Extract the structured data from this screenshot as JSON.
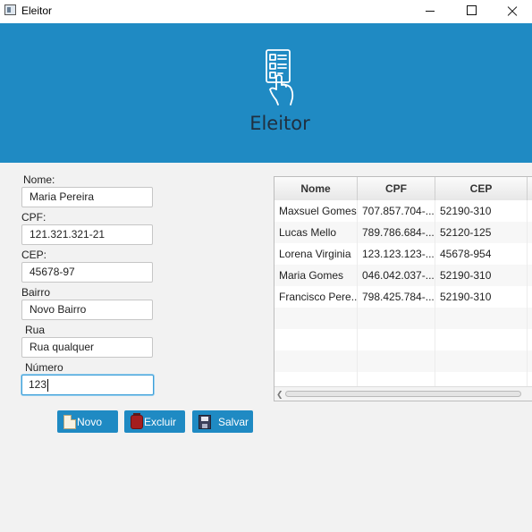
{
  "window": {
    "title": "Eleitor",
    "controls": [
      "minimize-icon",
      "maximize-icon",
      "close-icon"
    ]
  },
  "header": {
    "title": "Eleitor",
    "icon": "ballot-hand-icon",
    "background": "#1f8ac3"
  },
  "form": {
    "nome": {
      "label": "Nome:",
      "value": "Maria Pereira"
    },
    "cpf": {
      "label": "CPF:",
      "value": "121.321.321-21"
    },
    "cep": {
      "label": "CEP:",
      "value": "45678-97"
    },
    "bairro": {
      "label": "Bairro",
      "value": "Novo Bairro"
    },
    "rua": {
      "label": "Rua",
      "value": "Rua qualquer"
    },
    "numero": {
      "label": "Número",
      "value": "123"
    }
  },
  "buttons": {
    "novo": {
      "label": "Novo",
      "icon": "new-document-icon"
    },
    "excluir": {
      "label": "Excluir",
      "icon": "delete-icon"
    },
    "salvar": {
      "label": "Salvar",
      "icon": "floppy-disk-icon"
    }
  },
  "table": {
    "columns": [
      "Nome",
      "CPF",
      "CEP"
    ],
    "rows": [
      [
        "Maxsuel Gomes",
        "707.857.704-...",
        "52190-310"
      ],
      [
        "Lucas Mello",
        "789.786.684-...",
        "52120-125"
      ],
      [
        "Lorena Virginia",
        "123.123.123-...",
        "45678-954"
      ],
      [
        "Maria Gomes",
        "046.042.037-...",
        "52190-310"
      ],
      [
        "Francisco Pere...",
        "798.425.784-...",
        "52190-310"
      ]
    ]
  },
  "colors": {
    "accent": "#1f8ac3",
    "background": "#f2f2f2"
  }
}
